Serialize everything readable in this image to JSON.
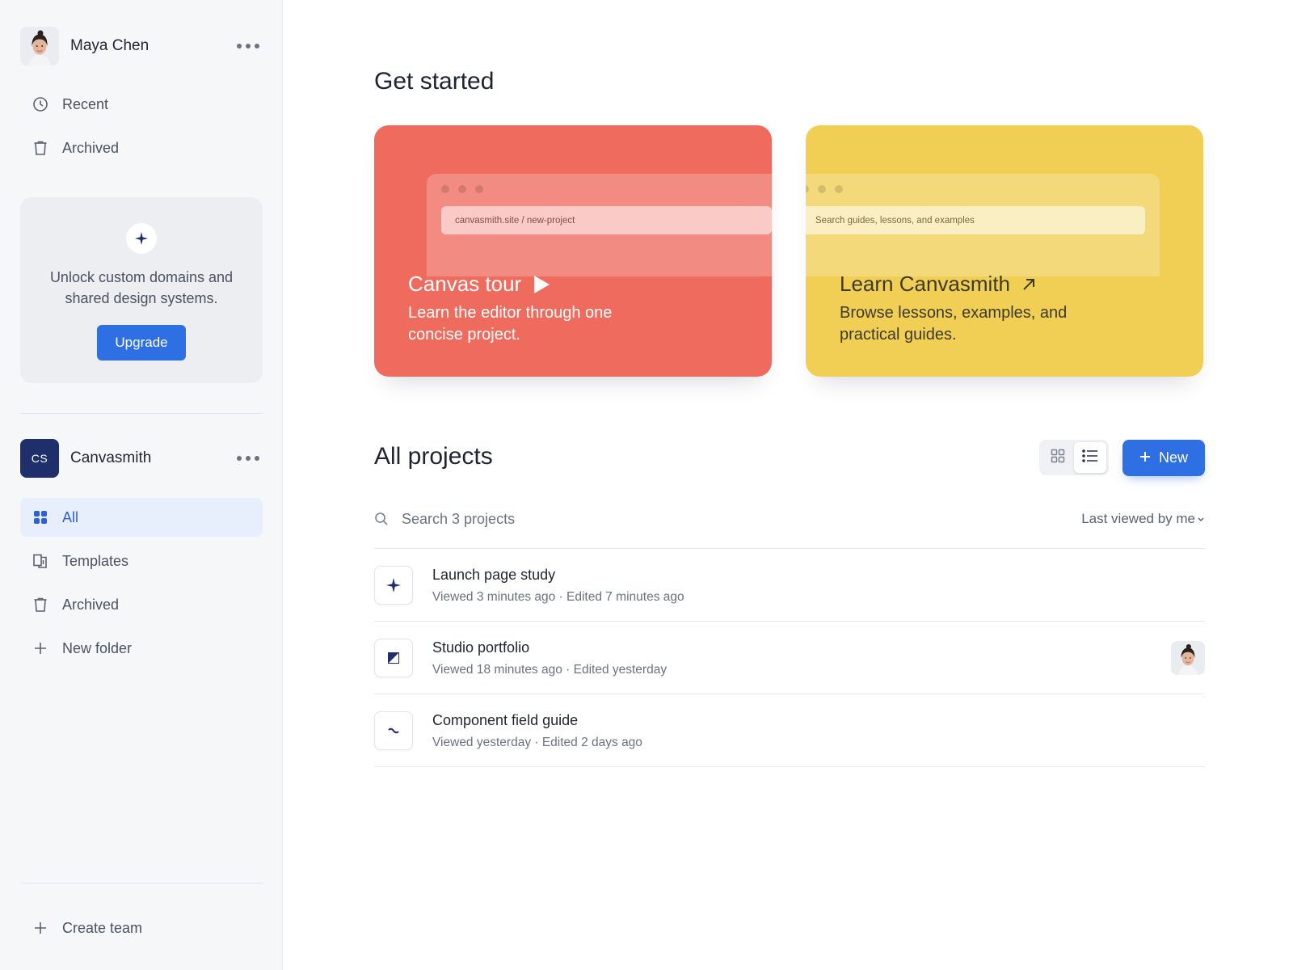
{
  "user": {
    "name": "Maya Chen"
  },
  "sidebar": {
    "top_items": [
      {
        "label": "Recent",
        "icon": "clock-icon"
      },
      {
        "label": "Archived",
        "icon": "trash-icon"
      }
    ],
    "promo": {
      "text": "Unlock custom domains and shared design systems.",
      "button": "Upgrade"
    },
    "team": {
      "initials": "CS",
      "name": "Canvasmith"
    },
    "team_items": [
      {
        "label": "All",
        "icon": "grid-icon",
        "active": true
      },
      {
        "label": "Templates",
        "icon": "templates-icon"
      },
      {
        "label": "Archived",
        "icon": "trash-icon"
      },
      {
        "label": "New folder",
        "icon": "plus-icon"
      }
    ],
    "create_team": "Create team"
  },
  "main": {
    "title": "Get started",
    "cards": {
      "tour": {
        "url": "canvasmith.site / new-project",
        "title": "Canvas tour",
        "desc": "Learn the editor through one concise project."
      },
      "learn": {
        "search": "Search guides, lessons, and examples",
        "title": "Learn Canvasmith",
        "desc": "Browse lessons, examples, and practical guides."
      }
    },
    "projects": {
      "title": "All projects",
      "new_label": "New",
      "search_placeholder": "Search 3 projects",
      "sort_label": "Last viewed by me",
      "items": [
        {
          "title": "Launch page study",
          "meta": "Viewed 3 minutes ago · Edited 7 minutes ago",
          "icon": "sparkle-icon"
        },
        {
          "title": "Studio portfolio",
          "meta": "Viewed 18 minutes ago · Edited yesterday",
          "icon": "frame-icon"
        },
        {
          "title": "Component field guide",
          "meta": "Viewed yesterday · Edited 2 days ago",
          "icon": "squiggle-icon"
        }
      ]
    }
  },
  "colors": {
    "accent": "#2f6fe4",
    "card_tour": "#ef6b5e",
    "card_learn": "#f1cf55",
    "team_badge": "#1e2f6b"
  }
}
